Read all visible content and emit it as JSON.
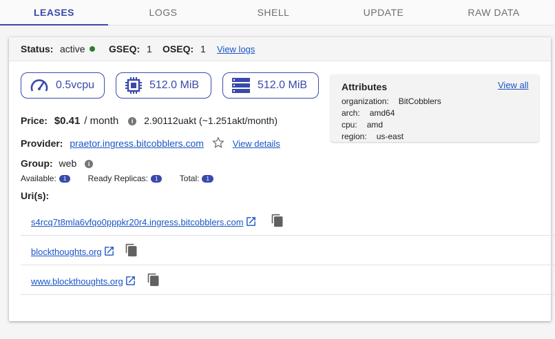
{
  "tabs": [
    "LEASES",
    "LOGS",
    "SHELL",
    "UPDATE",
    "RAW DATA"
  ],
  "status": {
    "status_label": "Status:",
    "status_value": "active",
    "gseq_label": "GSEQ:",
    "gseq_value": "1",
    "oseq_label": "OSEQ:",
    "oseq_value": "1",
    "view_logs": "View logs"
  },
  "resources": {
    "cpu": "0.5vcpu",
    "memory": "512.0 MiB",
    "storage": "512.0 MiB"
  },
  "attributes": {
    "title": "Attributes",
    "view_all": "View all",
    "items": [
      {
        "key": "organization:",
        "value": "BitCobblers"
      },
      {
        "key": "arch:",
        "value": "amd64"
      },
      {
        "key": "cpu:",
        "value": "amd"
      },
      {
        "key": "region:",
        "value": "us-east"
      }
    ]
  },
  "price": {
    "label": "Price:",
    "amount": "$0.41",
    "period": "/ month",
    "detail": "2.90112uakt (~1.251akt/month)"
  },
  "provider": {
    "label": "Provider:",
    "host": "praetor.ingress.bitcobblers.com",
    "view_details": "View details"
  },
  "group": {
    "label": "Group:",
    "value": "web"
  },
  "replicas": {
    "available_label": "Available:",
    "available": "1",
    "ready_label": "Ready Replicas:",
    "ready": "1",
    "total_label": "Total:",
    "total": "1"
  },
  "uris": {
    "label": "Uri(s):",
    "items": [
      "s4rcq7t8mla6vfqo0pppkr20r4.ingress.bitcobblers.com",
      "blockthoughts.org",
      "www.blockthoughts.org"
    ]
  },
  "colors": {
    "accent": "#3949ab",
    "link": "#1a55c5",
    "active_dot": "#2e7d32"
  }
}
